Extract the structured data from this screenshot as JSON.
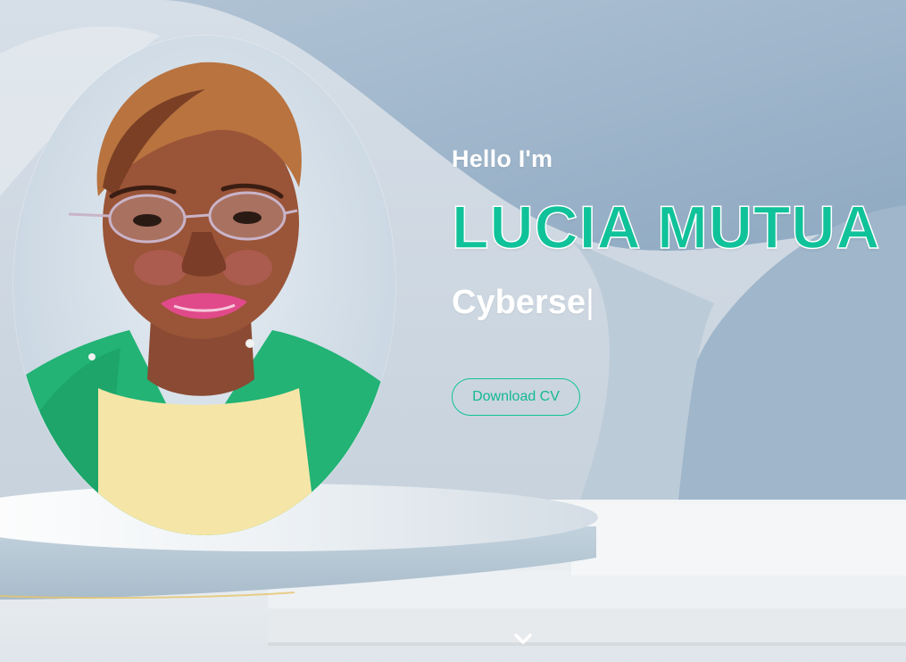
{
  "hero": {
    "greeting": "Hello I'm",
    "name": "LUCIA MUTUA",
    "typed_role": "Cyberse",
    "cursor": "|",
    "download_label": "Download CV"
  },
  "icons": {
    "scroll_down": "chevron-down-icon"
  },
  "colors": {
    "accent": "#10c29a",
    "background": "#c7d3df",
    "text": "#ffffff"
  }
}
